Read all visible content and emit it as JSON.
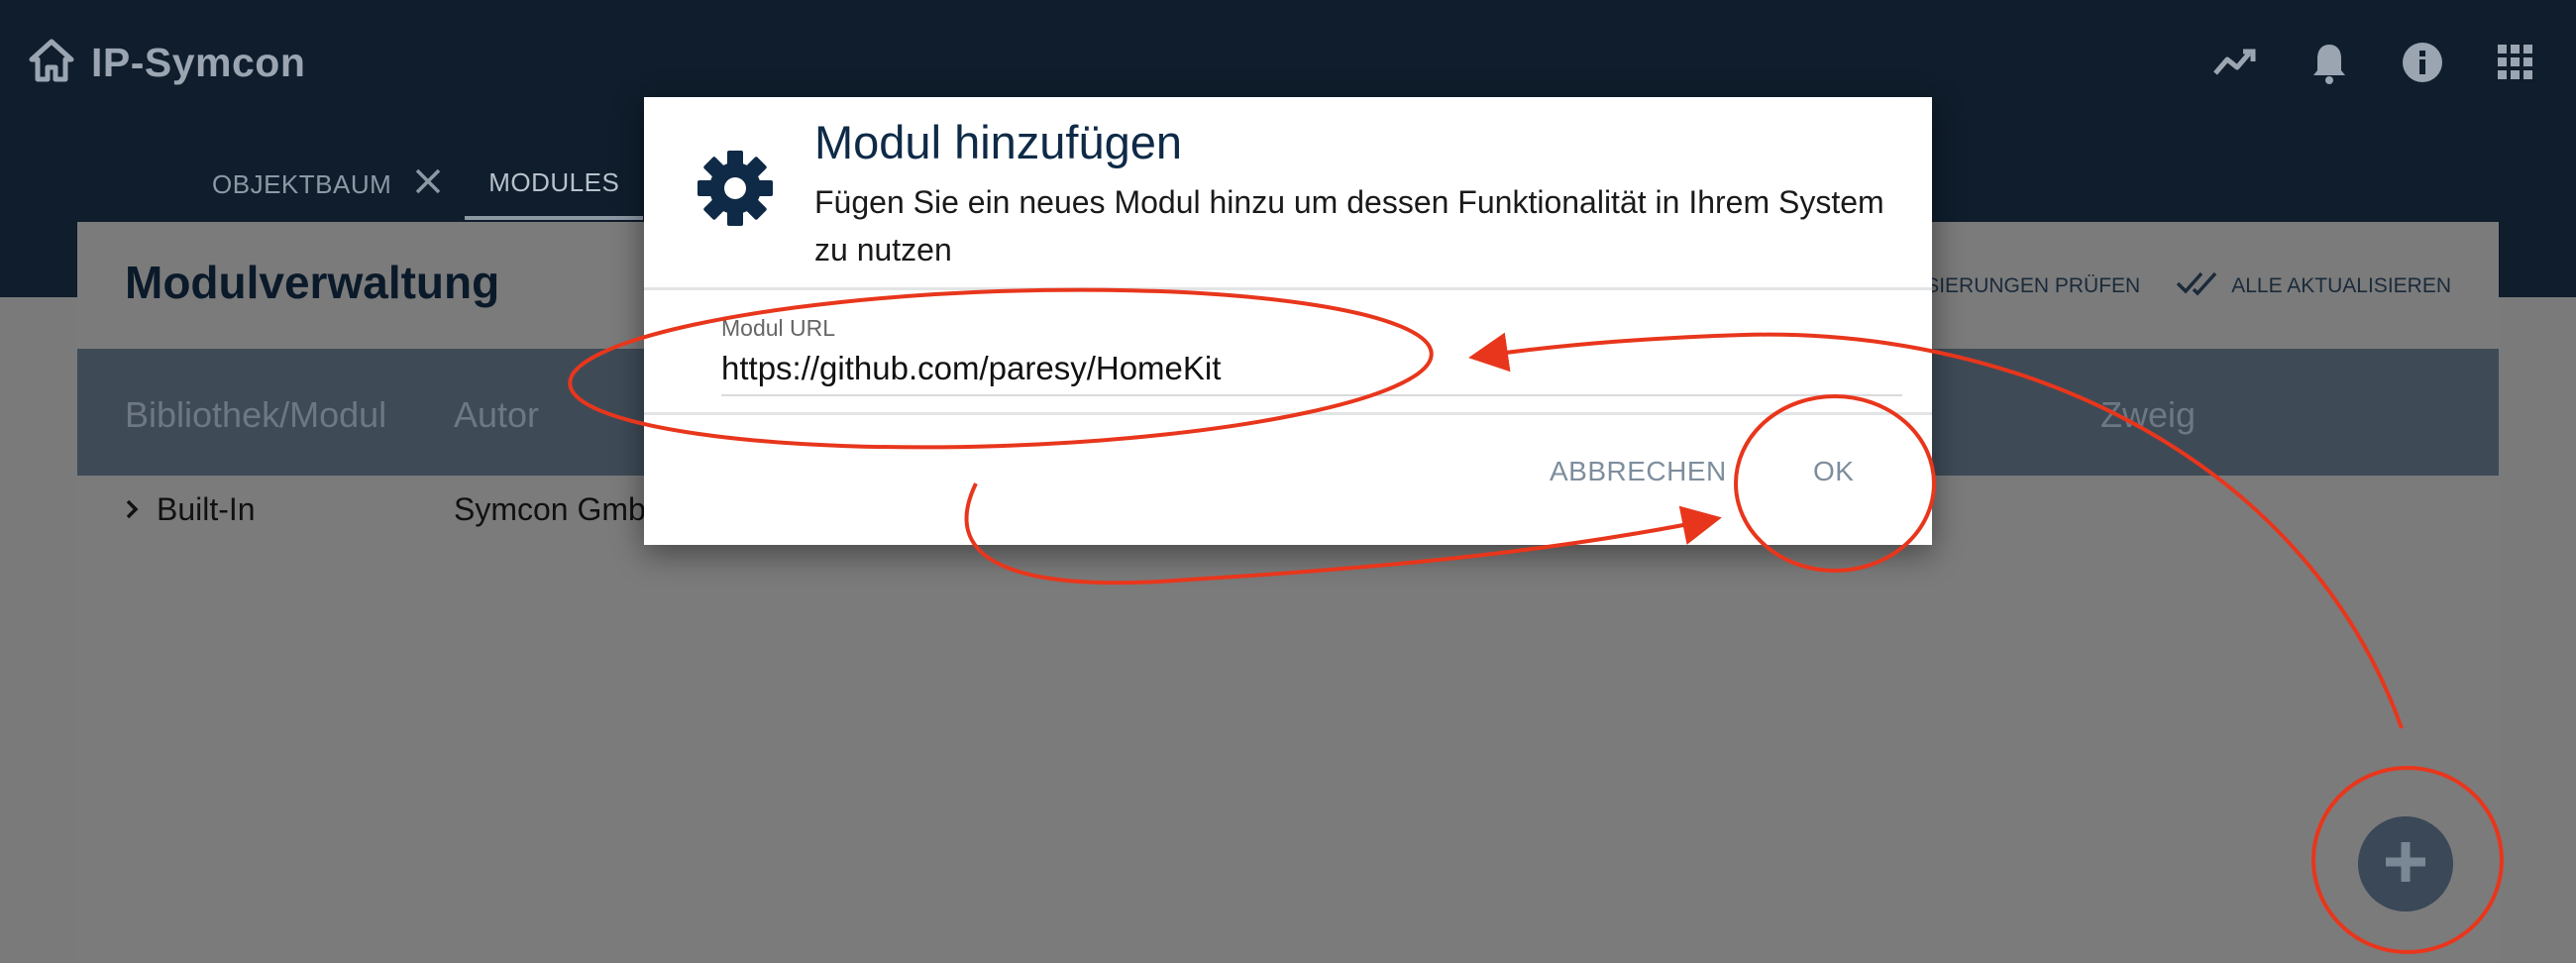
{
  "app": {
    "title": "IP-Symcon"
  },
  "topbar": {
    "icons": [
      "trend-icon",
      "bell-icon",
      "info-icon",
      "apps-grid-icon"
    ]
  },
  "tabs": [
    {
      "label": "OBJEKTBAUM",
      "closable": true
    },
    {
      "label": "MODULES",
      "active": true
    }
  ],
  "panel": {
    "title": "Modulverwaltung",
    "actions": {
      "check_updates": "AKTUALISIERUNGEN PRÜFEN",
      "update_all": "ALLE AKTUALISIEREN"
    }
  },
  "table": {
    "columns": [
      "Bibliothek/Modul",
      "Autor",
      "Zweig"
    ],
    "rows": [
      {
        "library": "Built-In",
        "author": "Symcon GmbH"
      }
    ]
  },
  "dialog": {
    "title": "Modul hinzufügen",
    "description": "Fügen Sie ein neues Modul hinzu um dessen Funktionalität in Ihrem System zu nutzen",
    "field_label": "Modul URL",
    "field_value": "https://github.com/paresy/HomeKit",
    "cancel_label": "ABBRECHEN",
    "ok_label": "OK"
  },
  "colors": {
    "topbar": "#0f2033",
    "accent": "#0e2a47",
    "annotation": "#e8361c",
    "overlay": "#7a7a7a"
  }
}
